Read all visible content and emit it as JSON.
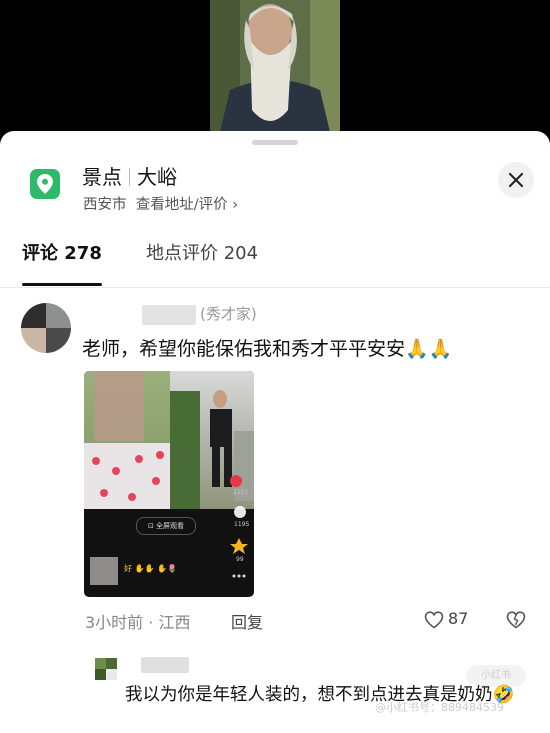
{
  "location": {
    "category": "景点",
    "name": "大峪",
    "city": "西安市",
    "address_link": "查看地址/评价",
    "chevron": "›"
  },
  "tabs": [
    {
      "label": "评论 278",
      "active": true
    },
    {
      "label": "地点评价 204",
      "active": false
    }
  ],
  "comment": {
    "username_suffix": "(秀才家)",
    "text": "老师，希望你能保佑我和秀才平平安安🙏🙏",
    "image": {
      "pill_text": "⊡ 全屏观看",
      "side_counts": [
        "2151",
        "1195",
        "99"
      ],
      "inner_comment": "好 ✋✋ ✋🌷"
    },
    "time_location": "3小时前 · 江西",
    "reply_label": "回复",
    "likes": "87"
  },
  "reply": {
    "text": "我以为你是年轻人装的，想不到点进去真是奶奶🤣",
    "watermark": "@小红书号：889484539",
    "watermark_badge": "小红书"
  },
  "colors": {
    "accent_green": "#2dbb6a",
    "text_primary": "#111111",
    "text_secondary": "#888888"
  },
  "icons": [
    "map-pin-icon",
    "close-icon",
    "heart-icon",
    "dislike-heart-icon"
  ]
}
